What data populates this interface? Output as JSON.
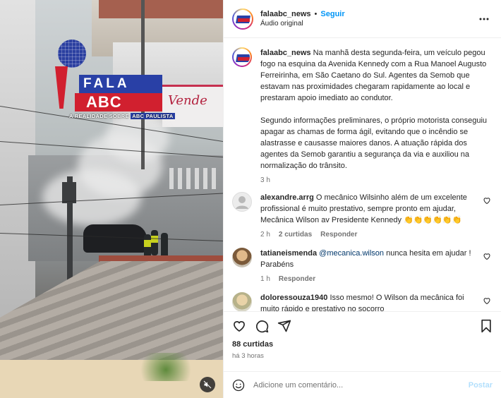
{
  "media": {
    "logo_top": "FALA",
    "logo_bottom": "ABC",
    "logo_tag_a": "A REALIDADE SOBRE",
    "logo_tag_b": "ABC PAULISTA",
    "store_sign": "Vende"
  },
  "header": {
    "username": "falaabc_news",
    "separator": "•",
    "follow_label": "Seguir",
    "audio_label": "Áudio original"
  },
  "caption": {
    "username": "falaabc_news",
    "paragraph1": "Na manhã desta segunda-feira, um veículo pegou fogo na esquina da Avenida Kennedy com a Rua Manoel Augusto Ferreirinha, em São Caetano do Sul. Agentes da Semob que estavam nas proximidades chegaram rapidamente ao local e prestaram apoio imediato ao condutor.",
    "paragraph2": "Segundo informações preliminares, o próprio motorista conseguiu apagar as chamas de forma ágil, evitando que o incêndio se alastrasse e causasse maiores danos. A atuação rápida dos agentes da Semob garantiu a segurança da via e auxiliou na normalização do trânsito.",
    "time": "3 h"
  },
  "comments": [
    {
      "username": "alexandre.arrg",
      "text": "O mecânico Wilsinho além de um excelente profissional é muito prestativo, sempre pronto em ajudar, Mecânica Wilson av Presidente Kennedy",
      "emoji": "👏👏👏👏👏👏",
      "time": "2 h",
      "likes": "2 curtidas",
      "reply": "Responder"
    },
    {
      "username": "tatianeismenda",
      "mention": "@mecanica.wilson",
      "text": "nunca hesita em ajudar ! Parabéns",
      "time": "1 h",
      "reply": "Responder"
    },
    {
      "username": "doloressouza1940",
      "text": "Isso mesmo! O Wilson da mecânica foi muito rápido e prestativo no socorro"
    }
  ],
  "footer": {
    "likes": "88 curtidas",
    "posted": "há 3 horas",
    "comment_placeholder": "Adicione um comentário...",
    "post_label": "Postar"
  },
  "colors": {
    "link_blue": "#0095f6",
    "post_disabled": "#b2dffc",
    "muted_text": "#737373"
  }
}
